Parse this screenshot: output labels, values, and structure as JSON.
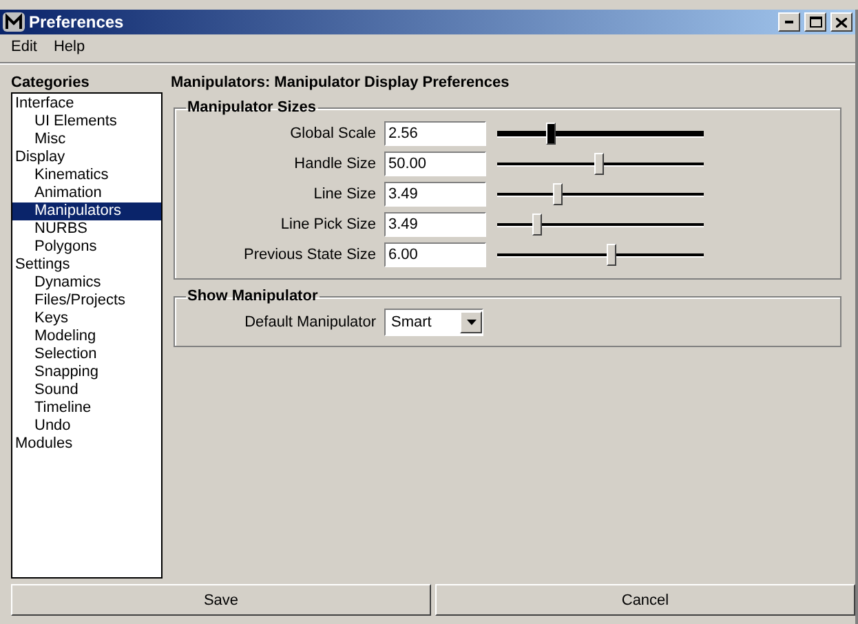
{
  "window": {
    "title": "Preferences"
  },
  "menu": [
    "Edit",
    "Help"
  ],
  "sidebar": {
    "title": "Categories",
    "items": [
      {
        "label": "Interface",
        "selected": false,
        "children": [
          {
            "label": "UI Elements",
            "selected": false
          },
          {
            "label": "Misc",
            "selected": false
          }
        ]
      },
      {
        "label": "Display",
        "selected": false,
        "children": [
          {
            "label": "Kinematics",
            "selected": false
          },
          {
            "label": "Animation",
            "selected": false
          },
          {
            "label": "Manipulators",
            "selected": true
          },
          {
            "label": "NURBS",
            "selected": false
          },
          {
            "label": "Polygons",
            "selected": false
          }
        ]
      },
      {
        "label": "Settings",
        "selected": false,
        "children": [
          {
            "label": "Dynamics",
            "selected": false
          },
          {
            "label": "Files/Projects",
            "selected": false
          },
          {
            "label": "Keys",
            "selected": false
          },
          {
            "label": "Modeling",
            "selected": false
          },
          {
            "label": "Selection",
            "selected": false
          },
          {
            "label": "Snapping",
            "selected": false
          },
          {
            "label": "Sound",
            "selected": false
          },
          {
            "label": "Timeline",
            "selected": false
          },
          {
            "label": "Undo",
            "selected": false
          }
        ]
      },
      {
        "label": "Modules",
        "selected": false
      }
    ]
  },
  "heading": "Manipulators: Manipulator Display Preferences",
  "sizes": {
    "title": "Manipulator Sizes",
    "rows": [
      {
        "label": "Global Scale",
        "value": "2.56",
        "level": 0.26,
        "focused": true
      },
      {
        "label": "Handle Size",
        "value": "50.00",
        "level": 0.49,
        "focused": false
      },
      {
        "label": "Line Size",
        "value": "3.49",
        "level": 0.29,
        "focused": false
      },
      {
        "label": "Line Pick Size",
        "value": "3.49",
        "level": 0.19,
        "focused": false
      },
      {
        "label": "Previous State Size",
        "value": "6.00",
        "level": 0.55,
        "focused": false
      }
    ]
  },
  "show": {
    "title": "Show Manipulator",
    "label": "Default Manipulator",
    "value": "Smart"
  },
  "buttons": [
    "Save",
    "Cancel"
  ]
}
